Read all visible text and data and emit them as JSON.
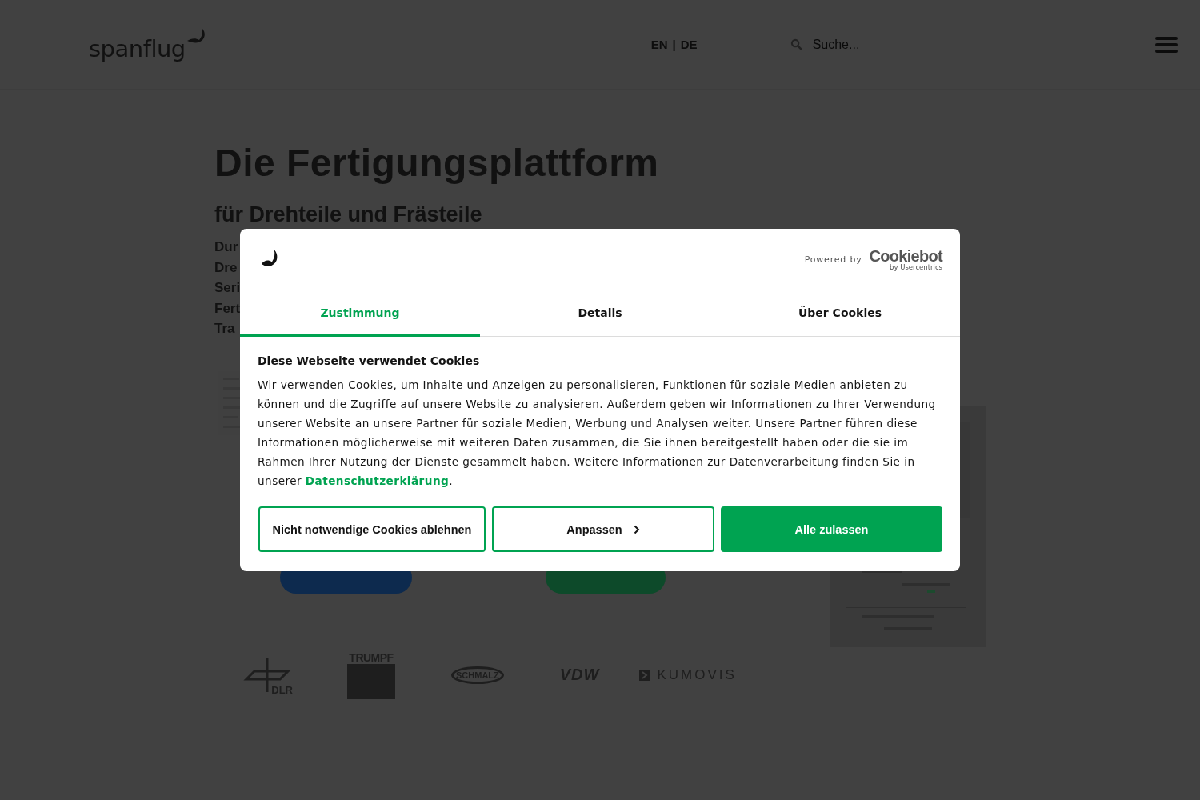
{
  "header": {
    "logo": "spanflug",
    "languages": [
      "EN",
      "DE"
    ],
    "language_separator": "|",
    "search": {
      "placeholder": "Suche..."
    }
  },
  "hero": {
    "title": "Die Fertigungsplattform",
    "subtitle": "für Drehteile und Frästeile",
    "lines": [
      "Dur",
      "Dre",
      "Seri",
      "Fert",
      "Tra"
    ],
    "buttons": [
      {
        "color": "#0d2a4e"
      },
      {
        "color": "#0d4a2a"
      }
    ]
  },
  "partners": [
    {
      "kind": "dlr",
      "label": "DLR"
    },
    {
      "kind": "trumpf",
      "label": "TRUMPF"
    },
    {
      "kind": "schmalz",
      "label": "SCHMALZ"
    },
    {
      "kind": "vdw",
      "label": "VDW"
    },
    {
      "kind": "kumovis",
      "label": "KUMOVIS"
    }
  ],
  "dialog": {
    "powered_by": "Powered by",
    "brand": "Cookiebot",
    "brand_sub": "by Usercentrics",
    "tabs": [
      {
        "label": "Zustimmung",
        "selected": true
      },
      {
        "label": "Details",
        "selected": false
      },
      {
        "label": "Über Cookies",
        "selected": false
      }
    ],
    "heading": "Diese Webseite verwendet Cookies",
    "body": "Wir verwenden Cookies, um Inhalte und Anzeigen zu personalisieren, Funktionen für soziale Medien anbieten zu können und die Zugriffe auf unsere Website zu analysieren. Außerdem geben wir Informationen zu Ihrer Verwendung unserer Website an unsere Partner für soziale Medien, Werbung und Analysen weiter. Unsere Partner führen diese Informationen möglicherweise mit weiteren Daten zusammen, die Sie ihnen bereitgestellt haben oder die sie im Rahmen Ihrer Nutzung der Dienste gesammelt haben. Weitere Informationen zur Datenverarbeitung finden Sie in unserer",
    "link": "Datenschutzerklärung",
    "body_end": ".",
    "buttons": [
      {
        "label": "Nicht notwendige Cookies ablehnen",
        "kind": "outline"
      },
      {
        "label": "Anpassen",
        "kind": "expand"
      },
      {
        "label": "Alle zulassen",
        "kind": "primary"
      }
    ]
  }
}
